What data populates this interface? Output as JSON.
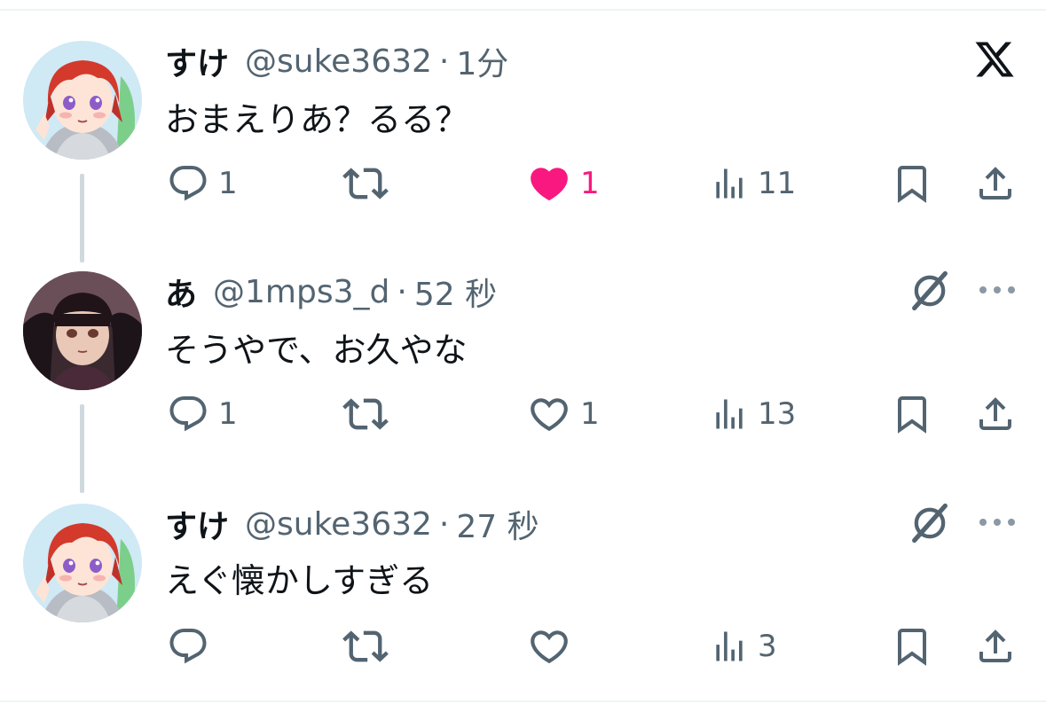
{
  "tweets": [
    {
      "name": "すけ",
      "handle": "@suke3632",
      "time": "1分",
      "text": "おまえりあ？るる？",
      "reply_count": "1",
      "like_count": "1",
      "liked": true,
      "views": "11"
    },
    {
      "name": "あ",
      "handle": "@1mps3_d",
      "time": "52 秒",
      "text": "そうやで、お久やな",
      "reply_count": "1",
      "like_count": "1",
      "liked": false,
      "views": "13"
    },
    {
      "name": "すけ",
      "handle": "@suke3632",
      "time": "27 秒",
      "text": "えぐ懐かしすぎる",
      "reply_count": "",
      "like_count": "",
      "liked": false,
      "views": "3"
    }
  ],
  "separator": "·",
  "icons": {
    "brand": "x-logo-icon",
    "reply": "speech-bubble-icon",
    "retweet": "retweet-arrows-icon",
    "like": "heart-icon",
    "views": "bar-chart-icon",
    "bookmark": "bookmark-icon",
    "share": "share-upload-icon",
    "grok": "grok-slash-icon",
    "more": "ellipsis-icon"
  },
  "colors": {
    "text_primary": "#0f1419",
    "text_secondary": "#536471",
    "like_active": "#f91880",
    "thread_line": "#cfd9de"
  }
}
